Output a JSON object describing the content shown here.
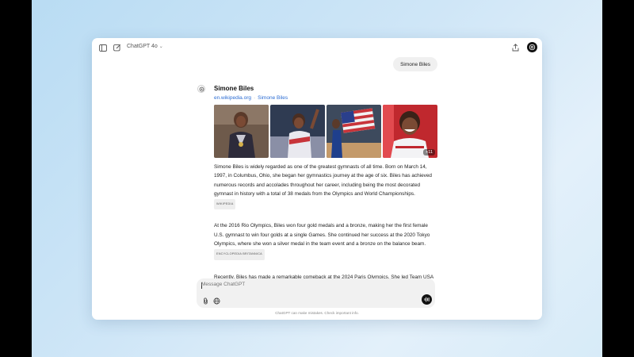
{
  "app": {
    "model_label": "ChatGPT 4o",
    "accent_color": "#2b6cd3"
  },
  "toolbar": {
    "icons": [
      "sidebar-icon",
      "new-chat-icon",
      "share-icon",
      "avatar-icon"
    ]
  },
  "conversation": {
    "user_message": "Simone Biles",
    "entity": {
      "title": "Simone Biles",
      "source_domain": "en.wikipedia.org",
      "source_separator": "·",
      "source_link": "Simone Biles"
    },
    "images": {
      "count": 4,
      "more_label": "+11"
    },
    "paragraphs": [
      {
        "text": "Simone Biles is widely regarded as one of the greatest gymnasts of all time. Born on March 14, 1997, in Columbus, Ohio, she began her gymnastics journey at the age of six. Biles has achieved numerous records and accolades throughout her career, including being the most decorated gymnast in history with a total of 38 medals from the Olympics and World Championships.",
        "tag": "WIKIPEDIA"
      },
      {
        "text": "At the 2016 Rio Olympics, Biles won four gold medals and a bronze, making her the first female U.S. gymnast to win four golds at a single Games. She continued her success at the 2020 Tokyo Olympics, where she won a silver medal in the team event and a bronze on the balance beam.",
        "tag": "ENCYCLOPEDIA BRITANNICA"
      },
      {
        "text": "Recently, Biles has made a remarkable comeback at the 2024 Paris Olympics. She led Team USA to a gold medal in the team final and won her second individual all-around gold medal, making her"
      }
    ]
  },
  "composer": {
    "placeholder": "Message ChatGPT"
  },
  "footer": {
    "note": "ChatGPT can make mistakes. Check important info."
  }
}
